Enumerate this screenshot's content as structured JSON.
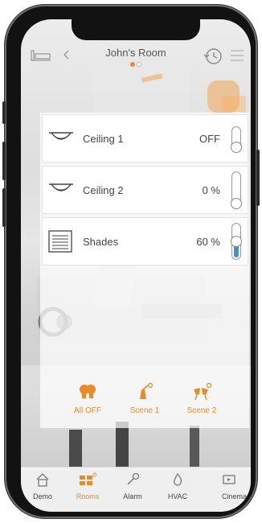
{
  "header": {
    "title": "John's Room",
    "back_icon": "chevron-left-icon",
    "home_icon": "bed-icon",
    "history_icon": "history-icon",
    "menu_icon": "hamburger-menu-icon",
    "page_dots": [
      true,
      false
    ]
  },
  "devices": [
    {
      "name": "Ceiling 1",
      "value": "OFF",
      "icon": "ceiling-light-icon",
      "level": 0
    },
    {
      "name": "Ceiling 2",
      "value": "0 %",
      "icon": "ceiling-light-icon",
      "level": 0
    },
    {
      "name": "Shades",
      "value": "60 %",
      "icon": "shades-icon",
      "level": 0.6
    }
  ],
  "scenes": [
    {
      "label": "All OFF",
      "icon": "lights-off-icon"
    },
    {
      "label": "Scene 1",
      "icon": "scene-lamp-icon"
    },
    {
      "label": "Scene 2",
      "icon": "scene-cheers-icon"
    }
  ],
  "nav": [
    {
      "label": "Demo",
      "icon": "house-icon",
      "active": false
    },
    {
      "label": "Rooms",
      "icon": "rooms-grid-icon",
      "active": true
    },
    {
      "label": "Alarm",
      "icon": "wrench-icon",
      "active": false
    },
    {
      "label": "HVAC",
      "icon": "flame-icon",
      "active": false
    },
    {
      "label": "Cinema",
      "icon": "tv-icon",
      "active": false
    }
  ],
  "colors": {
    "accent": "#e98a2e",
    "slider_fill": "#4a90c8",
    "text": "#444444"
  }
}
